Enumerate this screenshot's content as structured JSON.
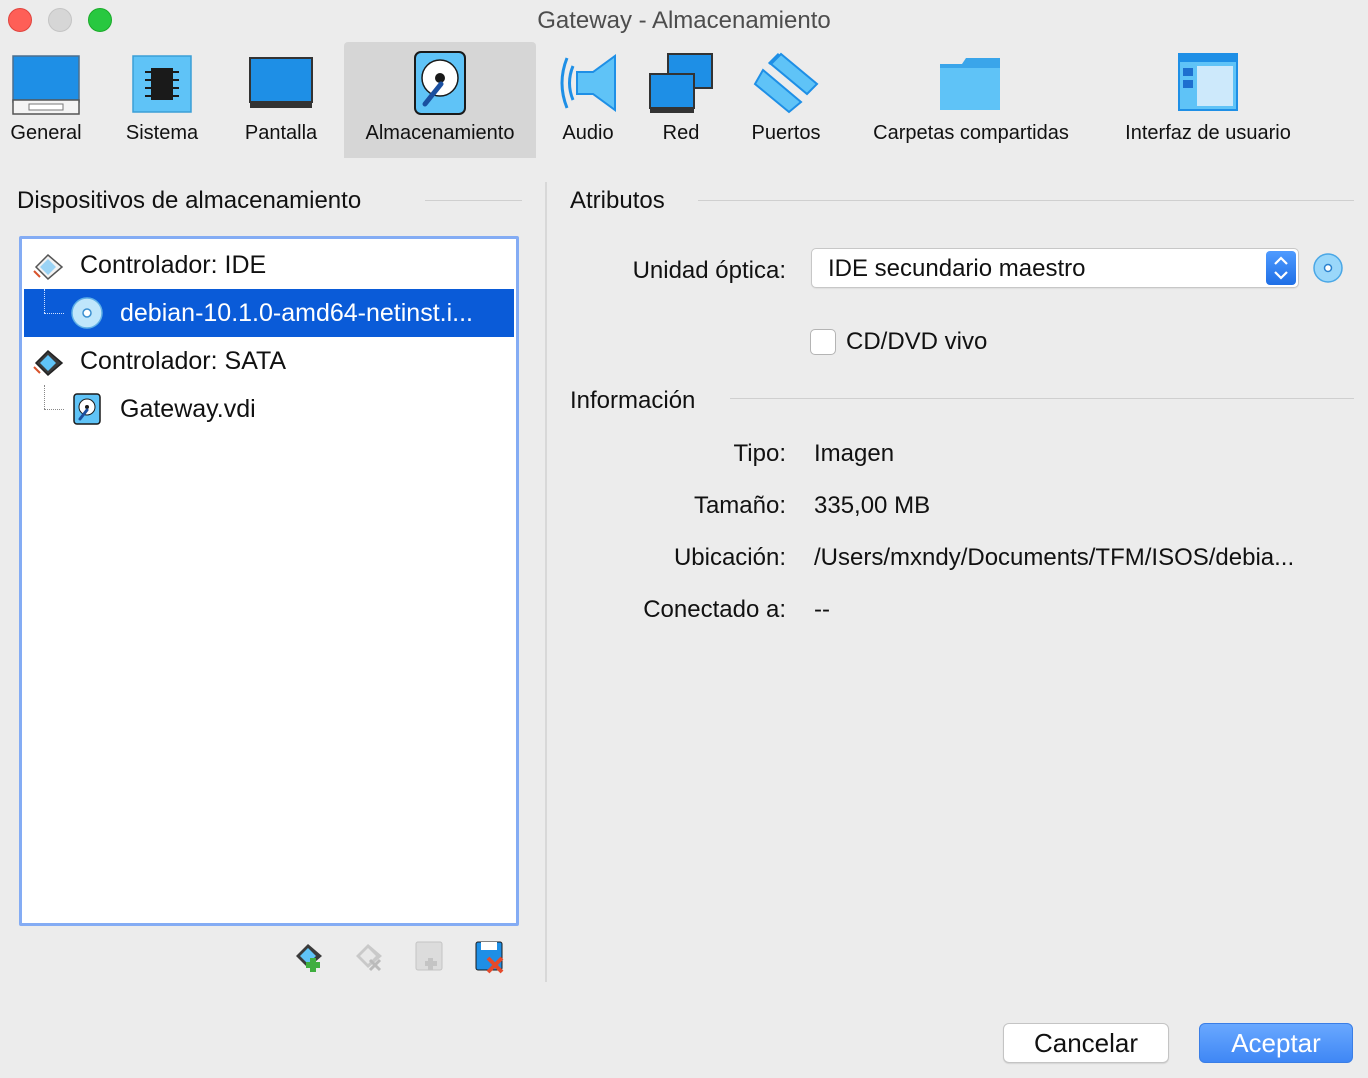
{
  "window": {
    "title": "Gateway - Almacenamiento"
  },
  "toolbar": {
    "items": [
      {
        "label": "General",
        "icon": "monitor-general-icon"
      },
      {
        "label": "Sistema",
        "icon": "chip-icon"
      },
      {
        "label": "Pantalla",
        "icon": "display-icon"
      },
      {
        "label": "Almacenamiento",
        "icon": "hard-disk-icon",
        "active": true
      },
      {
        "label": "Audio",
        "icon": "speaker-icon"
      },
      {
        "label": "Red",
        "icon": "network-icon"
      },
      {
        "label": "Puertos",
        "icon": "serial-port-icon"
      },
      {
        "label": "Carpetas compartidas",
        "icon": "folder-icon"
      },
      {
        "label": "Interfaz de usuario",
        "icon": "user-interface-icon"
      }
    ]
  },
  "storage": {
    "title": "Dispositivos de almacenamiento",
    "tree": [
      {
        "label": "Controlador: IDE",
        "type": "controller",
        "icon": "ide-controller-icon"
      },
      {
        "label": "debian-10.1.0-amd64-netinst.i...",
        "type": "optical",
        "icon": "optical-disc-icon",
        "selected": true
      },
      {
        "label": "Controlador: SATA",
        "type": "controller",
        "icon": "sata-controller-icon"
      },
      {
        "label": "Gateway.vdi",
        "type": "disk",
        "icon": "hard-disk-icon"
      }
    ],
    "actions": [
      "add-controller-icon",
      "remove-controller-icon",
      "add-attachment-icon",
      "remove-attachment-icon"
    ]
  },
  "attributes": {
    "title": "Atributos",
    "optical_drive_label": "Unidad óptica:",
    "optical_drive_value": "IDE secundario maestro",
    "live_cd_label": "CD/DVD vivo",
    "live_cd_checked": false
  },
  "info": {
    "title": "Información",
    "rows": [
      {
        "label": "Tipo:",
        "value": "Imagen"
      },
      {
        "label": "Tamaño:",
        "value": "335,00 MB"
      },
      {
        "label": "Ubicación:",
        "value": "/Users/mxndy/Documents/TFM/ISOS/debia..."
      },
      {
        "label": "Conectado a:",
        "value": "--"
      }
    ]
  },
  "buttons": {
    "cancel": "Cancelar",
    "ok": "Aceptar"
  },
  "colors": {
    "accent": "#0a5bd8",
    "window_bg": "#ececec",
    "ok_button": "#3f87f5"
  }
}
